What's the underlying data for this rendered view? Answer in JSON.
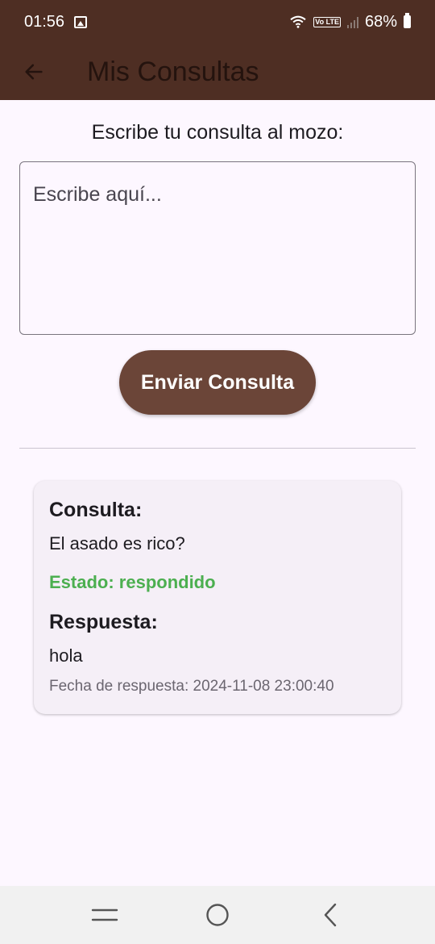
{
  "status_bar": {
    "time": "01:56",
    "battery": "68%",
    "network_badge": "Vo LTE"
  },
  "app_bar": {
    "title": "Mis Consultas"
  },
  "form": {
    "prompt": "Escribe tu consulta al mozo:",
    "placeholder": "Escribe aquí...",
    "send_label": "Enviar Consulta"
  },
  "consultas": [
    {
      "consulta_heading": "Consulta:",
      "consulta_text": "El asado es rico?",
      "estado": "Estado: respondido",
      "respuesta_heading": "Respuesta:",
      "respuesta_text": "hola",
      "fecha": "Fecha de respuesta: 2024-11-08 23:00:40"
    }
  ],
  "colors": {
    "app_bar": "#4e2e23",
    "button": "#6b4538",
    "status_ok": "#4caf50",
    "background": "#fdf7ff"
  },
  "icons": {
    "back": "arrow-back-icon",
    "gallery": "image-icon",
    "wifi": "wifi-icon",
    "signal": "signal-icon",
    "battery": "battery-icon",
    "nav_recents": "recents-icon",
    "nav_home": "home-icon",
    "nav_back": "chevron-left-icon"
  }
}
